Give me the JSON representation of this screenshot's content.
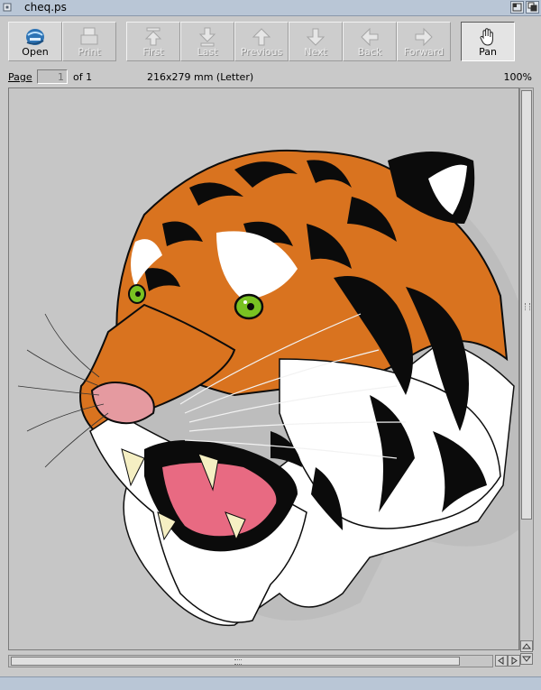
{
  "window": {
    "title": "cheq.ps"
  },
  "toolbar": {
    "open_label": "Open",
    "print_label": "Print",
    "first_label": "First",
    "last_label": "Last",
    "previous_label": "Previous",
    "next_label": "Next",
    "back_label": "Back",
    "forward_label": "Forward",
    "pan_label": "Pan"
  },
  "navigation": {
    "page_label": "Page",
    "current_page": "1",
    "of_label": "of 1",
    "paper_size": "216x279 mm (Letter)",
    "zoom": "100%"
  },
  "document": {
    "image_icon": "tiger-illustration",
    "colors": {
      "orange": "#d9731f",
      "black": "#0b0b0b",
      "white": "#ffffff",
      "eye": "#79c222",
      "mouth": "#e86a82",
      "nose": "#e59aa0"
    }
  }
}
